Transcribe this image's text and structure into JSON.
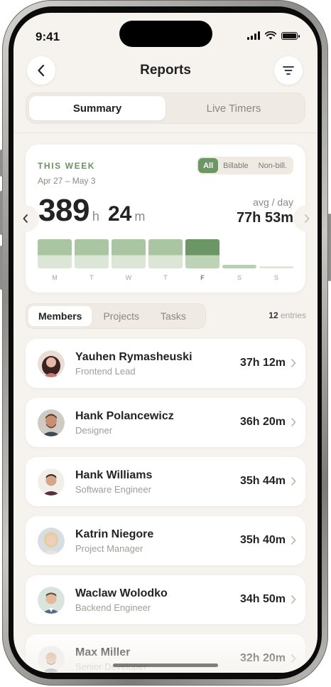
{
  "status": {
    "time": "9:41"
  },
  "header": {
    "title": "Reports",
    "back_icon": "chevron-left-icon",
    "filter_icon": "filter-icon"
  },
  "view_tabs": [
    {
      "label": "Summary",
      "active": true
    },
    {
      "label": "Live Timers",
      "active": false
    }
  ],
  "week": {
    "label": "THIS WEEK",
    "range": "Apr 27 – May 3",
    "filters": [
      {
        "label": "All",
        "active": true
      },
      {
        "label": "Billable",
        "active": false
      },
      {
        "label": "Non-bill.",
        "active": false
      }
    ],
    "total_hours": "389",
    "hours_unit": "h",
    "total_minutes": "24",
    "minutes_unit": "m",
    "avg_label": "avg / day",
    "avg_value": "77h 53m",
    "days": [
      {
        "label": "M",
        "level": 1.0,
        "active": false
      },
      {
        "label": "T",
        "level": 1.0,
        "active": false
      },
      {
        "label": "W",
        "level": 1.0,
        "active": false
      },
      {
        "label": "T",
        "level": 1.0,
        "active": false
      },
      {
        "label": "F",
        "level": 1.0,
        "active": true
      },
      {
        "label": "S",
        "level": 0.12,
        "active": false
      },
      {
        "label": "S",
        "level": 0.06,
        "active": false
      }
    ]
  },
  "group_tabs": [
    {
      "label": "Members",
      "active": true
    },
    {
      "label": "Projects",
      "active": false
    },
    {
      "label": "Tasks",
      "active": false
    }
  ],
  "entries": {
    "count": "12",
    "label": "entries"
  },
  "members": [
    {
      "name": "Yauhen Rymasheuski",
      "role": "Frontend Lead",
      "time": "37h 12m"
    },
    {
      "name": "Hank Polancewicz",
      "role": "Designer",
      "time": "36h 20m"
    },
    {
      "name": "Hank Williams",
      "role": "Software Engineer",
      "time": "35h 44m"
    },
    {
      "name": "Katrin Niegore",
      "role": "Project Manager",
      "time": "35h 40m"
    },
    {
      "name": "Waclaw Wolodko",
      "role": "Backend Engineer",
      "time": "34h 50m"
    },
    {
      "name": "Max Miller",
      "role": "Senior Developer",
      "time": "32h 20m"
    }
  ],
  "colors": {
    "accent": "#6d9666",
    "background": "#f6f3ee",
    "bar": "#a9c5a2"
  }
}
